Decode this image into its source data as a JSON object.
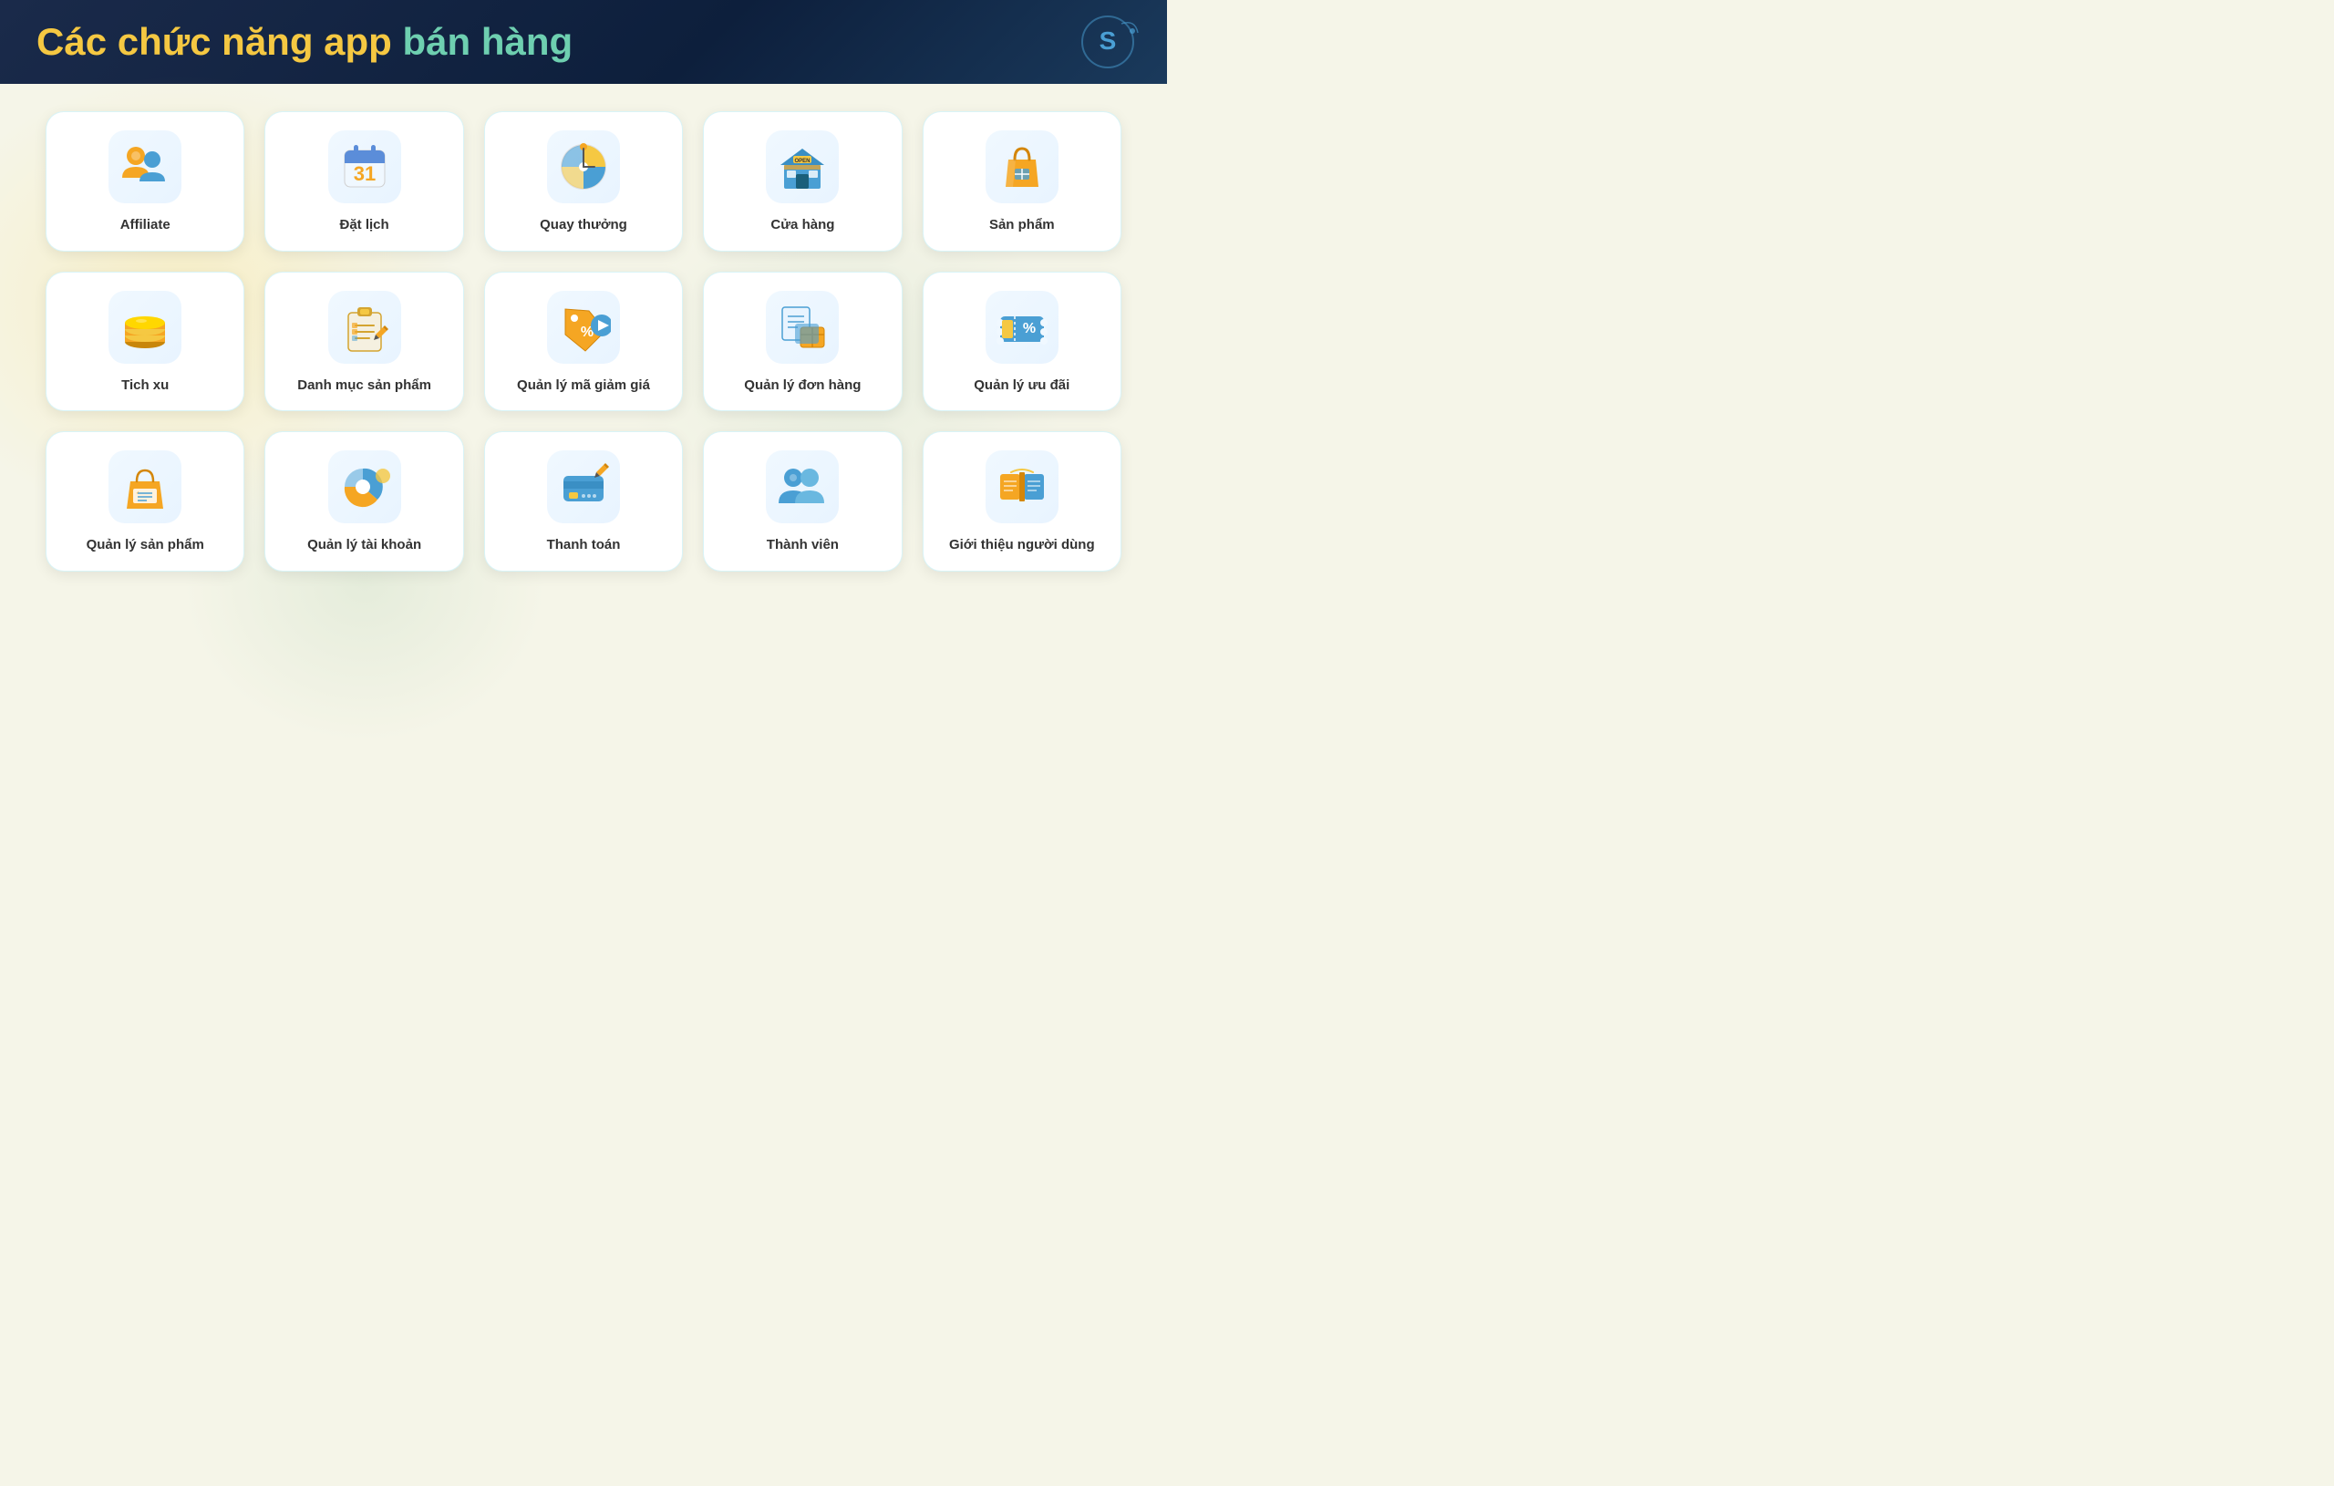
{
  "header": {
    "title_part1": "Các chức năng app ",
    "title_part2": "bán hàng",
    "title_color1": "#f5c842",
    "title_color2": "#6ecfb0"
  },
  "cards": [
    {
      "id": "affiliate",
      "label": "Affiliate",
      "icon_type": "affiliate",
      "row": 0
    },
    {
      "id": "dat-lich",
      "label": "Đặt lịch",
      "icon_type": "calendar",
      "row": 0
    },
    {
      "id": "quay-thuong",
      "label": "Quay thưởng",
      "icon_type": "spin",
      "row": 0
    },
    {
      "id": "cua-hang",
      "label": "Cửa hàng",
      "icon_type": "store",
      "row": 0
    },
    {
      "id": "san-pham",
      "label": "Sản phẩm",
      "icon_type": "product",
      "row": 0
    },
    {
      "id": "tich-xu",
      "label": "Tich xu",
      "icon_type": "coin",
      "row": 1
    },
    {
      "id": "danh-muc-san-pham",
      "label": "Danh mục sản phẩm",
      "icon_type": "clipboard",
      "row": 1
    },
    {
      "id": "quan-ly-ma-giam-gia",
      "label": "Quản lý mã giảm giá",
      "icon_type": "discount-tag",
      "row": 1
    },
    {
      "id": "quan-ly-don-hang",
      "label": "Quản lý đơn hàng",
      "icon_type": "order",
      "row": 1
    },
    {
      "id": "quan-ly-uu-dai",
      "label": "Quản lý ưu đãi",
      "icon_type": "voucher",
      "row": 1
    },
    {
      "id": "quan-ly-san-pham",
      "label": "Quản lý sản phẩm",
      "icon_type": "bag-list",
      "row": 2
    },
    {
      "id": "quan-ly-tai-khoan",
      "label": "Quản lý tài khoản",
      "icon_type": "account",
      "row": 2
    },
    {
      "id": "thanh-toan",
      "label": "Thanh toán",
      "icon_type": "payment",
      "row": 2
    },
    {
      "id": "thanh-vien",
      "label": "Thành viên",
      "icon_type": "members",
      "row": 2
    },
    {
      "id": "gioi-thieu-nguoi-dung",
      "label": "Giới thiệu người dùng",
      "icon_type": "referral",
      "row": 2
    }
  ]
}
